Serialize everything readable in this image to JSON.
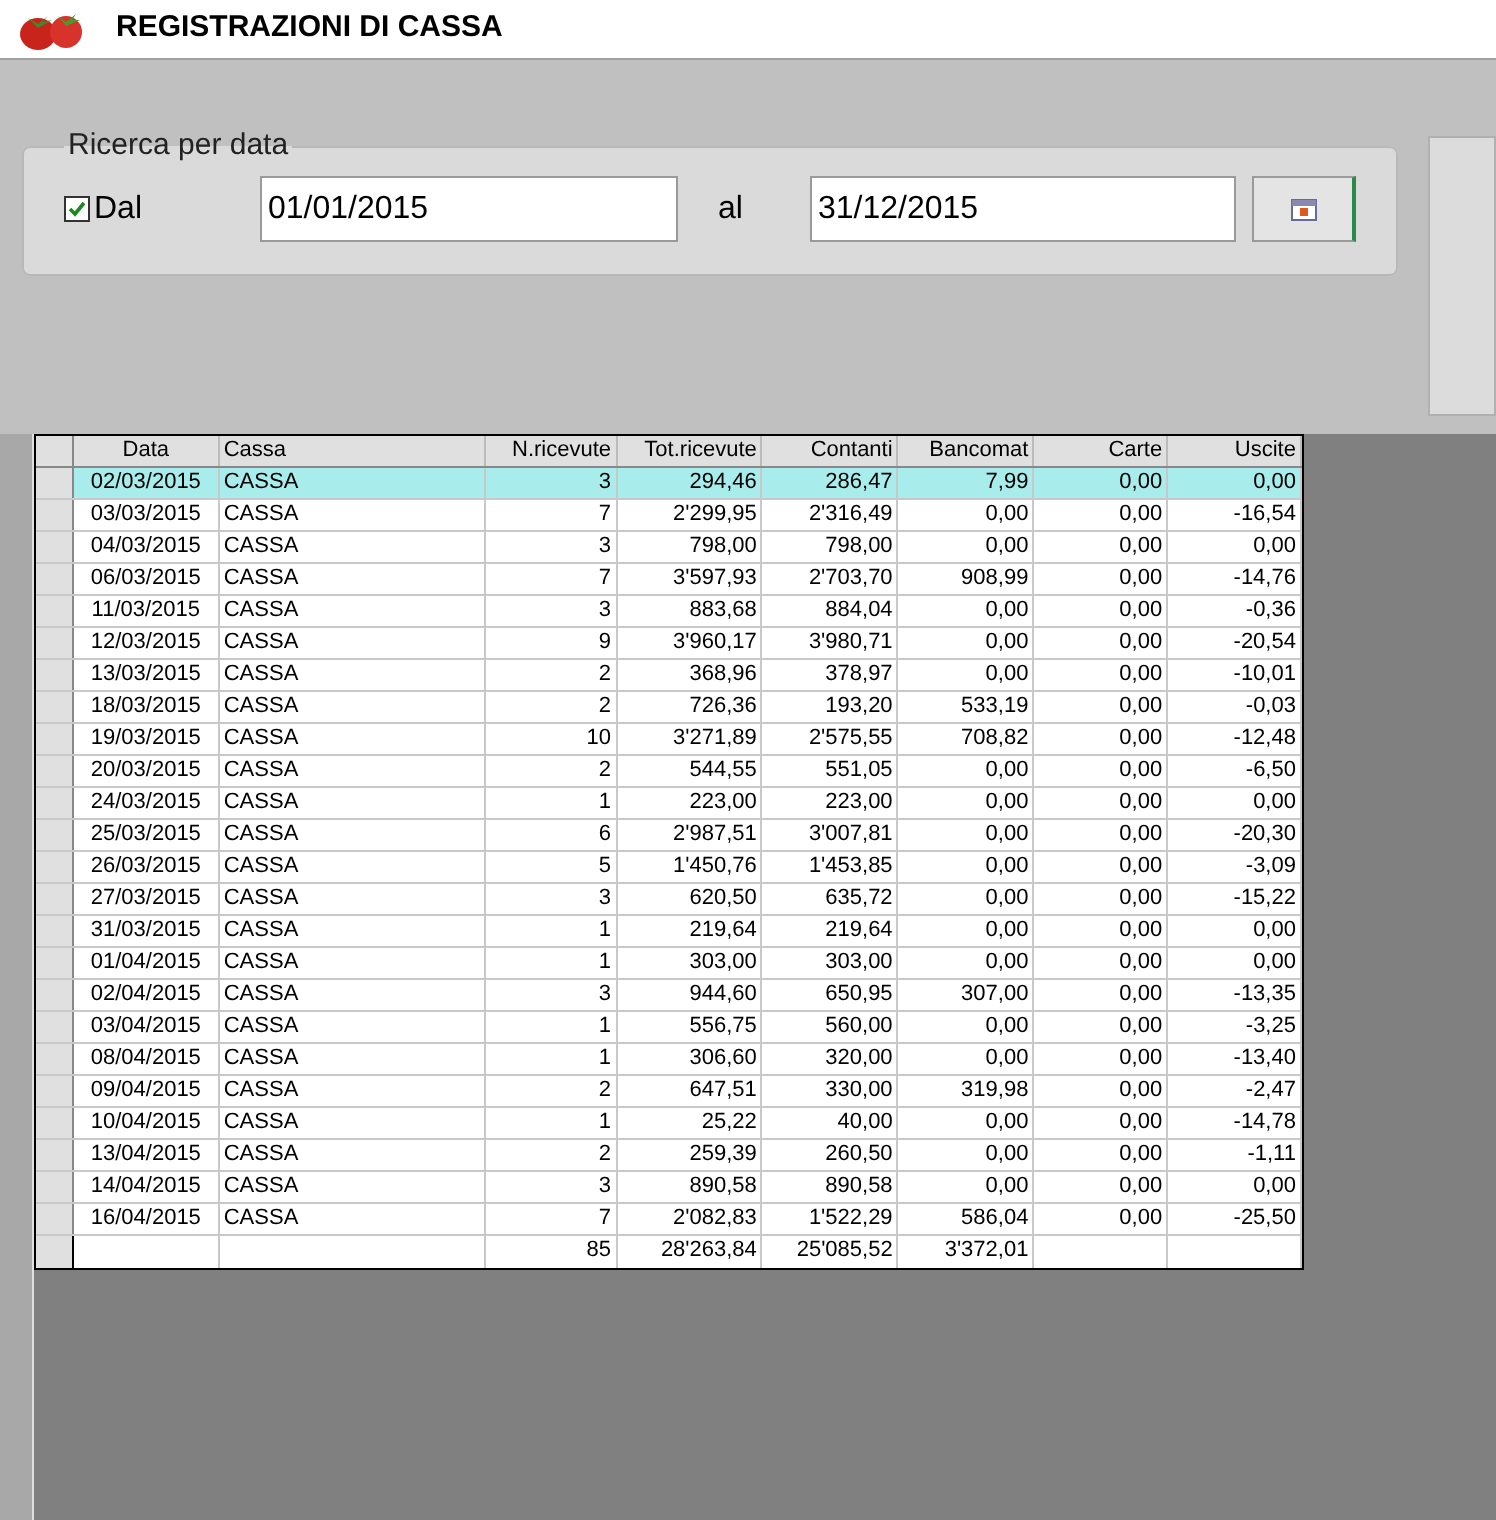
{
  "window": {
    "title": "REGISTRAZIONI DI CASSA"
  },
  "search": {
    "legend": "Ricerca per data",
    "from_checkbox": {
      "label": "Dal",
      "checked": true
    },
    "from_date": "01/01/2015",
    "to_label": "al",
    "to_date": "31/12/2015"
  },
  "table": {
    "columns": [
      "Data",
      "Cassa",
      "N.ricevute",
      "Tot.ricevute",
      "Contanti",
      "Bancomat",
      "Carte",
      "Uscite"
    ],
    "rows": [
      {
        "selected": true,
        "cells": [
          "02/03/2015",
          "CASSA",
          "3",
          "294,46",
          "286,47",
          "7,99",
          "0,00",
          "0,00"
        ]
      },
      {
        "selected": false,
        "cells": [
          "03/03/2015",
          "CASSA",
          "7",
          "2'299,95",
          "2'316,49",
          "0,00",
          "0,00",
          "-16,54"
        ]
      },
      {
        "selected": false,
        "cells": [
          "04/03/2015",
          "CASSA",
          "3",
          "798,00",
          "798,00",
          "0,00",
          "0,00",
          "0,00"
        ]
      },
      {
        "selected": false,
        "cells": [
          "06/03/2015",
          "CASSA",
          "7",
          "3'597,93",
          "2'703,70",
          "908,99",
          "0,00",
          "-14,76"
        ]
      },
      {
        "selected": false,
        "cells": [
          "11/03/2015",
          "CASSA",
          "3",
          "883,68",
          "884,04",
          "0,00",
          "0,00",
          "-0,36"
        ]
      },
      {
        "selected": false,
        "cells": [
          "12/03/2015",
          "CASSA",
          "9",
          "3'960,17",
          "3'980,71",
          "0,00",
          "0,00",
          "-20,54"
        ]
      },
      {
        "selected": false,
        "cells": [
          "13/03/2015",
          "CASSA",
          "2",
          "368,96",
          "378,97",
          "0,00",
          "0,00",
          "-10,01"
        ]
      },
      {
        "selected": false,
        "cells": [
          "18/03/2015",
          "CASSA",
          "2",
          "726,36",
          "193,20",
          "533,19",
          "0,00",
          "-0,03"
        ]
      },
      {
        "selected": false,
        "cells": [
          "19/03/2015",
          "CASSA",
          "10",
          "3'271,89",
          "2'575,55",
          "708,82",
          "0,00",
          "-12,48"
        ]
      },
      {
        "selected": false,
        "cells": [
          "20/03/2015",
          "CASSA",
          "2",
          "544,55",
          "551,05",
          "0,00",
          "0,00",
          "-6,50"
        ]
      },
      {
        "selected": false,
        "cells": [
          "24/03/2015",
          "CASSA",
          "1",
          "223,00",
          "223,00",
          "0,00",
          "0,00",
          "0,00"
        ]
      },
      {
        "selected": false,
        "cells": [
          "25/03/2015",
          "CASSA",
          "6",
          "2'987,51",
          "3'007,81",
          "0,00",
          "0,00",
          "-20,30"
        ]
      },
      {
        "selected": false,
        "cells": [
          "26/03/2015",
          "CASSA",
          "5",
          "1'450,76",
          "1'453,85",
          "0,00",
          "0,00",
          "-3,09"
        ]
      },
      {
        "selected": false,
        "cells": [
          "27/03/2015",
          "CASSA",
          "3",
          "620,50",
          "635,72",
          "0,00",
          "0,00",
          "-15,22"
        ]
      },
      {
        "selected": false,
        "cells": [
          "31/03/2015",
          "CASSA",
          "1",
          "219,64",
          "219,64",
          "0,00",
          "0,00",
          "0,00"
        ]
      },
      {
        "selected": false,
        "cells": [
          "01/04/2015",
          "CASSA",
          "1",
          "303,00",
          "303,00",
          "0,00",
          "0,00",
          "0,00"
        ]
      },
      {
        "selected": false,
        "cells": [
          "02/04/2015",
          "CASSA",
          "3",
          "944,60",
          "650,95",
          "307,00",
          "0,00",
          "-13,35"
        ]
      },
      {
        "selected": false,
        "cells": [
          "03/04/2015",
          "CASSA",
          "1",
          "556,75",
          "560,00",
          "0,00",
          "0,00",
          "-3,25"
        ]
      },
      {
        "selected": false,
        "cells": [
          "08/04/2015",
          "CASSA",
          "1",
          "306,60",
          "320,00",
          "0,00",
          "0,00",
          "-13,40"
        ]
      },
      {
        "selected": false,
        "cells": [
          "09/04/2015",
          "CASSA",
          "2",
          "647,51",
          "330,00",
          "319,98",
          "0,00",
          "-2,47"
        ]
      },
      {
        "selected": false,
        "cells": [
          "10/04/2015",
          "CASSA",
          "1",
          "25,22",
          "40,00",
          "0,00",
          "0,00",
          "-14,78"
        ]
      },
      {
        "selected": false,
        "cells": [
          "13/04/2015",
          "CASSA",
          "2",
          "259,39",
          "260,50",
          "0,00",
          "0,00",
          "-1,11"
        ]
      },
      {
        "selected": false,
        "cells": [
          "14/04/2015",
          "CASSA",
          "3",
          "890,58",
          "890,58",
          "0,00",
          "0,00",
          "0,00"
        ]
      },
      {
        "selected": false,
        "cells": [
          "16/04/2015",
          "CASSA",
          "7",
          "2'082,83",
          "1'522,29",
          "586,04",
          "0,00",
          "-25,50"
        ]
      }
    ],
    "totals": {
      "n_ricevute": "85",
      "tot_ricevute": "28'263,84",
      "contanti": "25'085,52",
      "bancomat": "3'372,01"
    }
  }
}
